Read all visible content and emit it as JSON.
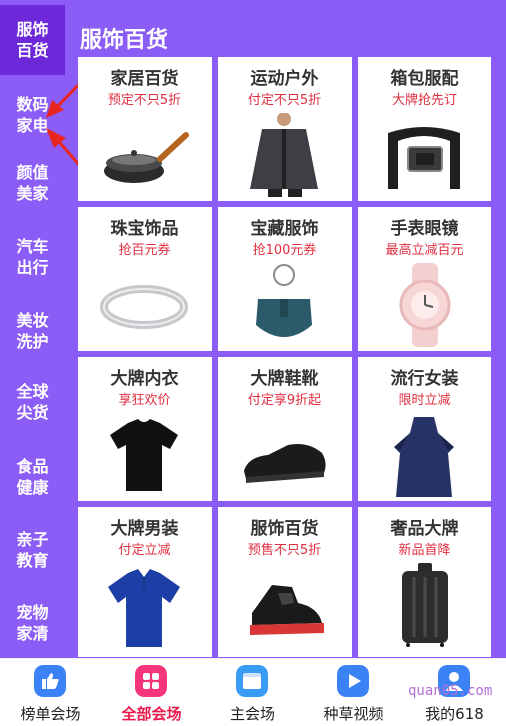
{
  "colors": {
    "brand_purple": "#8b5cf6",
    "active_purple": "#6d28d9",
    "sub_red": "#e02e3f",
    "tab_active": "#e8194c"
  },
  "sidebar": {
    "items": [
      {
        "label": "服饰\n百货",
        "active": true
      },
      {
        "label": "数码\n家电"
      },
      {
        "label": "颜值\n美家"
      },
      {
        "label": "汽车\n出行"
      },
      {
        "label": "美妆\n洗护"
      },
      {
        "label": "全球\n尖货"
      },
      {
        "label": "食品\n健康"
      },
      {
        "label": "亲子\n教育"
      },
      {
        "label": "宠物\n家清"
      }
    ]
  },
  "section": {
    "title": "服饰百货"
  },
  "categories": [
    {
      "title": "家居百货",
      "subtitle": "预定不只5折",
      "icon": "wok-pan-icon"
    },
    {
      "title": "运动户外",
      "subtitle": "付定不只5折",
      "icon": "jacket-icon"
    },
    {
      "title": "箱包服配",
      "subtitle": "大牌抢先订",
      "icon": "belt-icon"
    },
    {
      "title": "珠宝饰品",
      "subtitle": "抢百元券",
      "icon": "bangle-icon"
    },
    {
      "title": "宝藏服饰",
      "subtitle": "抢100元券",
      "icon": "handbag-icon"
    },
    {
      "title": "手表眼镜",
      "subtitle": "最高立减百元",
      "icon": "watch-icon"
    },
    {
      "title": "大牌内衣",
      "subtitle": "享狂欢价",
      "icon": "tshirt-icon"
    },
    {
      "title": "大牌鞋靴",
      "subtitle": "付定享9折起",
      "icon": "leather-shoe-icon"
    },
    {
      "title": "流行女装",
      "subtitle": "限时立减",
      "icon": "dress-icon"
    },
    {
      "title": "大牌男装",
      "subtitle": "付定立减",
      "icon": "polo-shirt-icon"
    },
    {
      "title": "服饰百货",
      "subtitle": "预售不只5折",
      "icon": "sneaker-icon"
    },
    {
      "title": "奢品大牌",
      "subtitle": "新品首降",
      "icon": "suitcase-icon"
    }
  ],
  "tabbar": {
    "tabs": [
      {
        "label": "榜单会场",
        "icon": "thumbs-up-icon",
        "color": "#3b82f6"
      },
      {
        "label": "全部会场",
        "icon": "grid-icon",
        "color": "#f5367a",
        "active": true
      },
      {
        "label": "主会场",
        "icon": "venue-icon",
        "color": "#3b9cf6"
      },
      {
        "label": "种草视频",
        "icon": "play-icon",
        "color": "#3b82f6"
      },
      {
        "label": "我的618",
        "icon": "profile-icon",
        "color": "#3b82f6"
      }
    ]
  },
  "watermark": "quan05.com"
}
